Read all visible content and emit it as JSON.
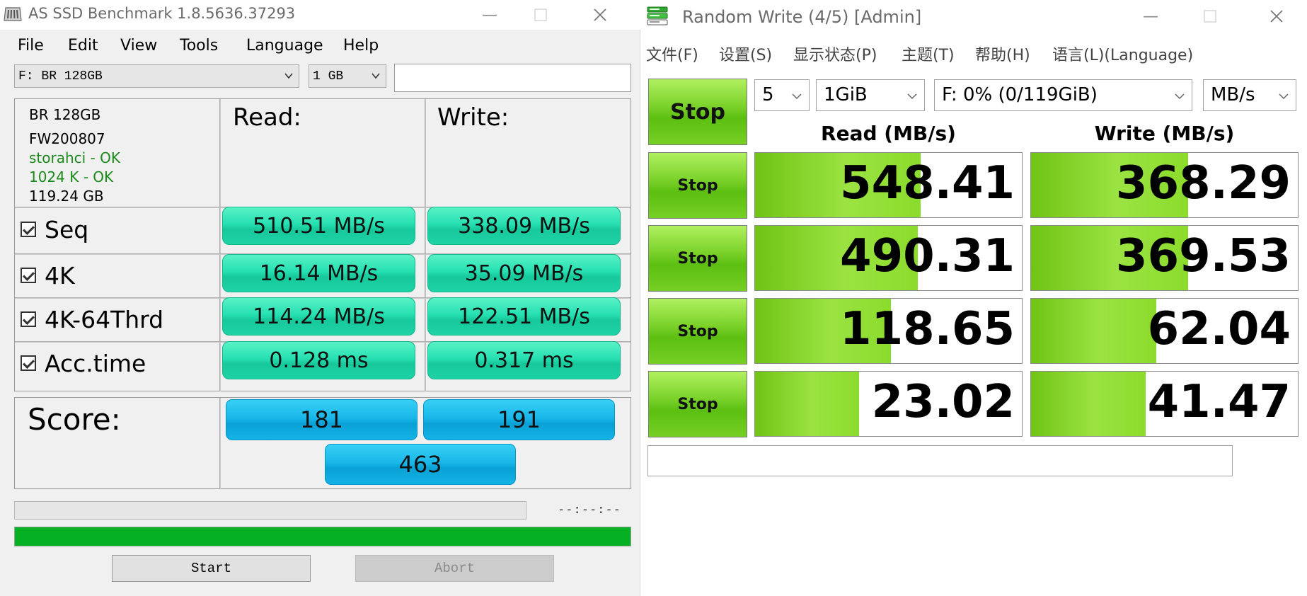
{
  "as_ssd": {
    "title": "AS SSD Benchmark 1.8.5636.37293",
    "menu": [
      "File",
      "Edit",
      "View",
      "Tools",
      "Language",
      "Help"
    ],
    "drive_select": "F: BR 128GB",
    "size_select": "1 GB",
    "drive_info": {
      "model": "BR 128GB",
      "firmware": "FW200807",
      "driver": "storahci - OK",
      "alignment": "1024 K - OK",
      "capacity": "119.24 GB"
    },
    "read_header": "Read:",
    "write_header": "Write:",
    "rows": [
      {
        "label": "Seq",
        "read": "510.51 MB/s",
        "write": "338.09 MB/s"
      },
      {
        "label": "4K",
        "read": "16.14 MB/s",
        "write": "35.09 MB/s"
      },
      {
        "label": "4K-64Thrd",
        "read": "114.24 MB/s",
        "write": "122.51 MB/s"
      },
      {
        "label": "Acc.time",
        "read": "0.128 ms",
        "write": "0.317 ms"
      }
    ],
    "score_label": "Score:",
    "score_read": "181",
    "score_write": "191",
    "score_total": "463",
    "time_display": "--:--:--",
    "progress_fraction": 1.0,
    "start_label": "Start",
    "abort_label": "Abort",
    "colors": {
      "result": "#26e0b2",
      "score": "#19b8ea",
      "progress": "#06b025"
    }
  },
  "cdm": {
    "title": "Random Write (4/5) [Admin]",
    "menu": [
      "文件(F)",
      "设置(S)",
      "显示状态(P)",
      "主题(T)",
      "帮助(H)",
      "语言(L)(Language)"
    ],
    "main_stop_label": "Stop",
    "count_select": "5",
    "size_select": "1GiB",
    "drive_select": "F: 0% (0/119GiB)",
    "unit_select": "MB/s",
    "read_header": "Read (MB/s)",
    "write_header": "Write (MB/s)",
    "rows": [
      {
        "stop_label": "Stop",
        "read": "548.41",
        "read_fill": 0.62,
        "write": "368.29",
        "write_fill": 0.59
      },
      {
        "stop_label": "Stop",
        "read": "490.31",
        "read_fill": 0.61,
        "write": "369.53",
        "write_fill": 0.59
      },
      {
        "stop_label": "Stop",
        "read": "118.65",
        "read_fill": 0.51,
        "write": "62.04",
        "write_fill": 0.47
      },
      {
        "stop_label": "Stop",
        "read": "23.02",
        "read_fill": 0.39,
        "write": "41.47",
        "write_fill": 0.43
      }
    ],
    "colors": {
      "stop": "#7dd32c",
      "bar": "#9be342"
    }
  }
}
